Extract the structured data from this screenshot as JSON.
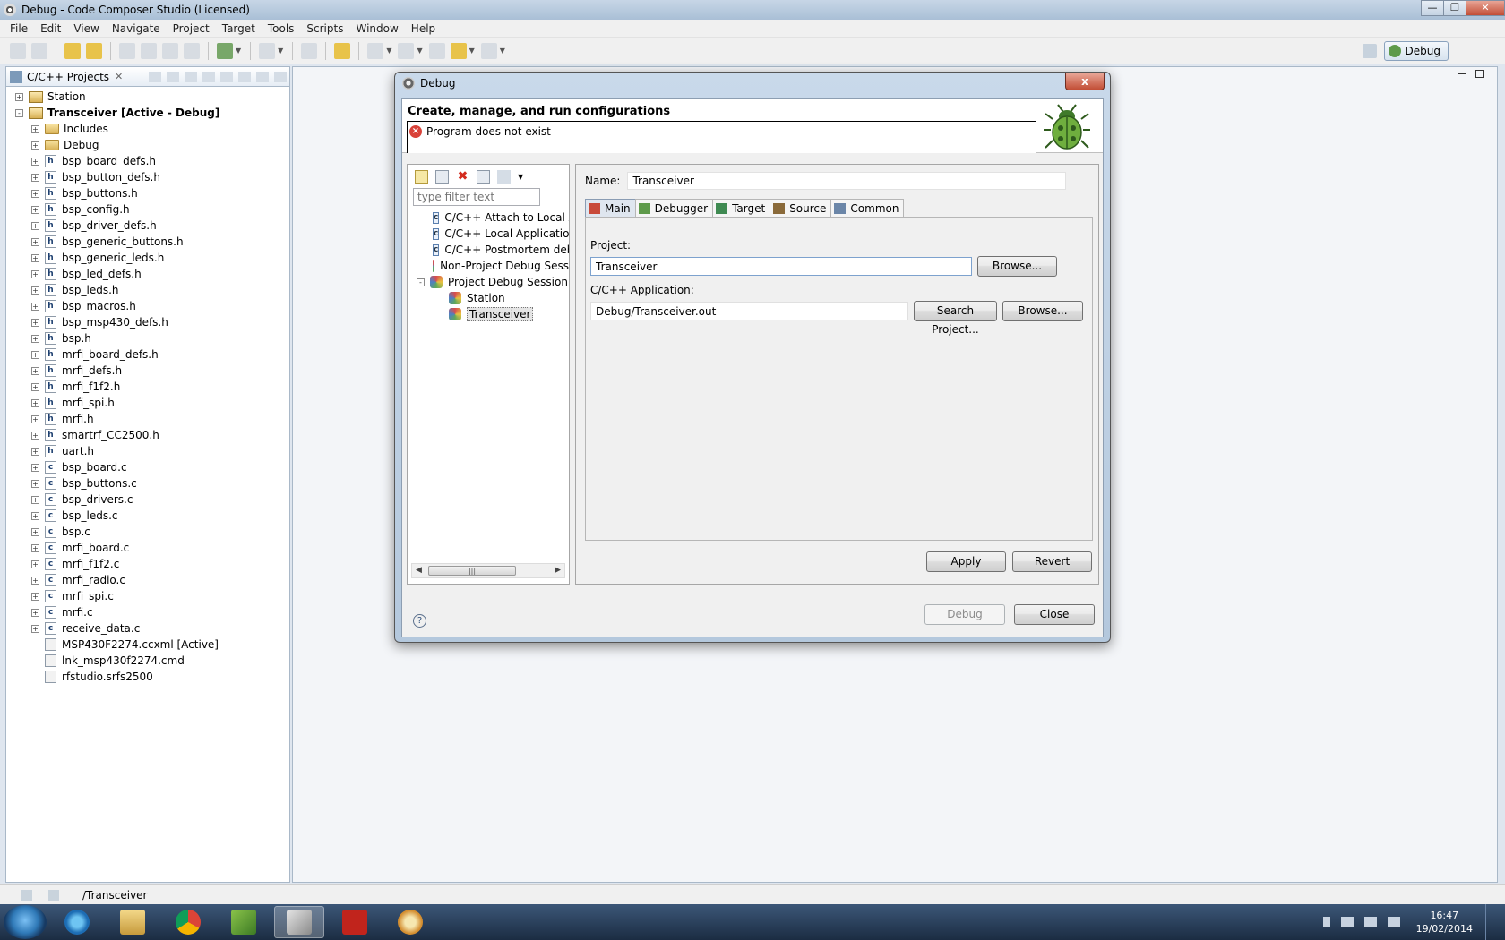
{
  "window": {
    "title": "Debug - Code Composer Studio (Licensed)"
  },
  "menu": [
    "File",
    "Edit",
    "View",
    "Navigate",
    "Project",
    "Target",
    "Tools",
    "Scripts",
    "Window",
    "Help"
  ],
  "perspective": {
    "label": "Debug"
  },
  "explorer": {
    "tab_label": "C/C++ Projects",
    "items": [
      {
        "label": "Station",
        "kind": "project",
        "depth": 0,
        "expander": "+"
      },
      {
        "label": "Transceiver  [Active - Debug]",
        "kind": "project",
        "depth": 0,
        "expander": "-",
        "bold": true
      },
      {
        "label": "Includes",
        "kind": "folder",
        "depth": 1,
        "expander": "+"
      },
      {
        "label": "Debug",
        "kind": "folder",
        "depth": 1,
        "expander": "+"
      },
      {
        "label": "bsp_board_defs.h",
        "kind": "h",
        "depth": 1,
        "expander": "+"
      },
      {
        "label": "bsp_button_defs.h",
        "kind": "h",
        "depth": 1,
        "expander": "+"
      },
      {
        "label": "bsp_buttons.h",
        "kind": "h",
        "depth": 1,
        "expander": "+"
      },
      {
        "label": "bsp_config.h",
        "kind": "h",
        "depth": 1,
        "expander": "+"
      },
      {
        "label": "bsp_driver_defs.h",
        "kind": "h",
        "depth": 1,
        "expander": "+"
      },
      {
        "label": "bsp_generic_buttons.h",
        "kind": "h",
        "depth": 1,
        "expander": "+"
      },
      {
        "label": "bsp_generic_leds.h",
        "kind": "h",
        "depth": 1,
        "expander": "+"
      },
      {
        "label": "bsp_led_defs.h",
        "kind": "h",
        "depth": 1,
        "expander": "+"
      },
      {
        "label": "bsp_leds.h",
        "kind": "h",
        "depth": 1,
        "expander": "+"
      },
      {
        "label": "bsp_macros.h",
        "kind": "h",
        "depth": 1,
        "expander": "+"
      },
      {
        "label": "bsp_msp430_defs.h",
        "kind": "h",
        "depth": 1,
        "expander": "+"
      },
      {
        "label": "bsp.h",
        "kind": "h",
        "depth": 1,
        "expander": "+"
      },
      {
        "label": "mrfi_board_defs.h",
        "kind": "h",
        "depth": 1,
        "expander": "+"
      },
      {
        "label": "mrfi_defs.h",
        "kind": "h",
        "depth": 1,
        "expander": "+"
      },
      {
        "label": "mrfi_f1f2.h",
        "kind": "h",
        "depth": 1,
        "expander": "+"
      },
      {
        "label": "mrfi_spi.h",
        "kind": "h",
        "depth": 1,
        "expander": "+"
      },
      {
        "label": "mrfi.h",
        "kind": "h",
        "depth": 1,
        "expander": "+"
      },
      {
        "label": "smartrf_CC2500.h",
        "kind": "h",
        "depth": 1,
        "expander": "+"
      },
      {
        "label": "uart.h",
        "kind": "h",
        "depth": 1,
        "expander": "+"
      },
      {
        "label": "bsp_board.c",
        "kind": "c",
        "depth": 1,
        "expander": "+"
      },
      {
        "label": "bsp_buttons.c",
        "kind": "c",
        "depth": 1,
        "expander": "+"
      },
      {
        "label": "bsp_drivers.c",
        "kind": "c",
        "depth": 1,
        "expander": "+"
      },
      {
        "label": "bsp_leds.c",
        "kind": "c",
        "depth": 1,
        "expander": "+"
      },
      {
        "label": "bsp.c",
        "kind": "c",
        "depth": 1,
        "expander": "+"
      },
      {
        "label": "mrfi_board.c",
        "kind": "c",
        "depth": 1,
        "expander": "+"
      },
      {
        "label": "mrfi_f1f2.c",
        "kind": "c",
        "depth": 1,
        "expander": "+"
      },
      {
        "label": "mrfi_radio.c",
        "kind": "c",
        "depth": 1,
        "expander": "+"
      },
      {
        "label": "mrfi_spi.c",
        "kind": "c",
        "depth": 1,
        "expander": "+"
      },
      {
        "label": "mrfi.c",
        "kind": "c",
        "depth": 1,
        "expander": "+"
      },
      {
        "label": "receive_data.c",
        "kind": "c",
        "depth": 1,
        "expander": "+"
      },
      {
        "label": "MSP430F2274.ccxml [Active]",
        "kind": "cfg",
        "depth": 1,
        "expander": ""
      },
      {
        "label": "lnk_msp430f2274.cmd",
        "kind": "cfg",
        "depth": 1,
        "expander": ""
      },
      {
        "label": "rfstudio.srfs2500",
        "kind": "cfg",
        "depth": 1,
        "expander": ""
      }
    ]
  },
  "statusbar": {
    "path": "/Transceiver"
  },
  "taskbar": {
    "time": "16:47",
    "date": "19/02/2014"
  },
  "dialog": {
    "title": "Debug",
    "close_glyph": "x",
    "heading": "Create, manage, and run configurations",
    "error_message": "Program does not exist",
    "filter_placeholder": "type filter text",
    "config_tree": [
      {
        "label": "C/C++ Attach to Local A",
        "kind": "c",
        "depth": 1,
        "expander": ""
      },
      {
        "label": "C/C++ Local Application",
        "kind": "c",
        "depth": 1,
        "expander": ""
      },
      {
        "label": "C/C++ Postmortem deb",
        "kind": "c",
        "depth": 1,
        "expander": ""
      },
      {
        "label": "Non-Project Debug Sess",
        "kind": "np",
        "depth": 1,
        "expander": ""
      },
      {
        "label": "Project Debug Session",
        "kind": "np",
        "depth": 1,
        "expander": "-"
      },
      {
        "label": "Station",
        "kind": "np",
        "depth": 2,
        "expander": ""
      },
      {
        "label": "Transceiver",
        "kind": "np",
        "depth": 2,
        "expander": "",
        "selected": true
      }
    ],
    "name_label": "Name:",
    "name_value": "Transceiver",
    "tabs": [
      {
        "label": "Main",
        "active": true,
        "icon": "main-tab-icon",
        "color": "#c84a3a"
      },
      {
        "label": "Debugger",
        "active": false,
        "icon": "bug-tab-icon",
        "color": "#5e9a4a"
      },
      {
        "label": "Target",
        "active": false,
        "icon": "target-tab-icon",
        "color": "#3f8a52"
      },
      {
        "label": "Source",
        "active": false,
        "icon": "source-tab-icon",
        "color": "#8a6a3a"
      },
      {
        "label": "Common",
        "active": false,
        "icon": "common-tab-icon",
        "color": "#6b86a8"
      }
    ],
    "project_label": "Project:",
    "project_value": "Transceiver",
    "application_label": "C/C++ Application:",
    "application_value": "Debug/Transceiver.out",
    "browse_label": "Browse...",
    "search_project_label": "Search Project...",
    "apply_label": "Apply",
    "revert_label": "Revert",
    "debug_label": "Debug",
    "close_label": "Close",
    "help_glyph": "?"
  }
}
